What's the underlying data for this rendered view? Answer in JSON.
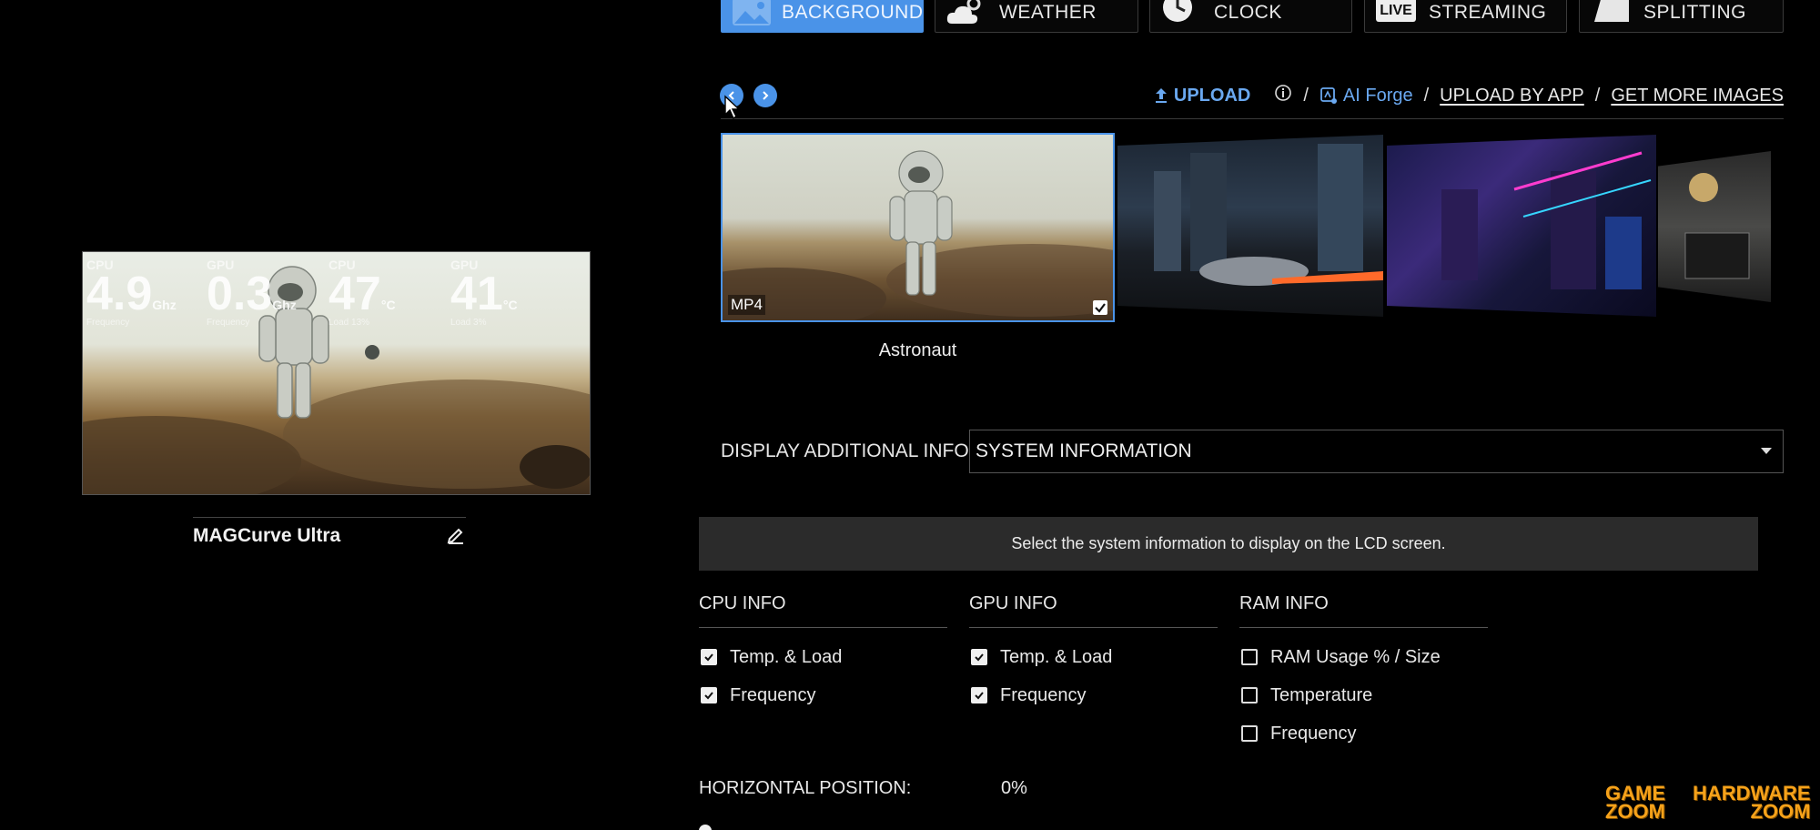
{
  "tabs": [
    {
      "label": "BACKGROUND",
      "icon": "image-icon",
      "active": true
    },
    {
      "label": "WEATHER",
      "icon": "weather-icon",
      "active": false
    },
    {
      "label": "CLOCK",
      "icon": "clock-icon",
      "active": false
    },
    {
      "label": "STREAMING",
      "icon": "live-icon",
      "badge": "LIVE",
      "active": false
    },
    {
      "label": "SPLITTING",
      "icon": "split-icon",
      "active": false
    }
  ],
  "preview": {
    "hud": [
      {
        "caption": "CPU",
        "value": "4.9",
        "unit": "Ghz",
        "sub": "Frequency"
      },
      {
        "caption": "GPU",
        "value": "0.3",
        "unit": "Ghz",
        "sub": "Frequency"
      },
      {
        "caption": "CPU",
        "value": "47",
        "unit": "°C",
        "sub": "Load    13%"
      },
      {
        "caption": "GPU",
        "value": "41",
        "unit": "°C",
        "sub": "Load    3%"
      }
    ],
    "device_name": "MAGCurve Ultra"
  },
  "header_links": {
    "upload": "UPLOAD",
    "ai_forge": "AI Forge",
    "separator": "/",
    "upload_by_app": "UPLOAD BY APP",
    "get_more_images": "GET MORE IMAGES"
  },
  "carousel": {
    "selected": {
      "badge": "MP4",
      "title": "Astronaut"
    }
  },
  "display_info": {
    "label": "DISPLAY ADDITIONAL INFO",
    "selected": "SYSTEM INFORMATION",
    "hint": "Select the system information to display on the LCD screen."
  },
  "columns": [
    {
      "title": "CPU INFO",
      "options": [
        {
          "label": "Temp. & Load",
          "checked": true
        },
        {
          "label": "Frequency",
          "checked": true
        }
      ]
    },
    {
      "title": "GPU INFO",
      "options": [
        {
          "label": "Temp. & Load",
          "checked": true
        },
        {
          "label": "Frequency",
          "checked": true
        }
      ]
    },
    {
      "title": "RAM INFO",
      "options": [
        {
          "label": "RAM Usage % / Size",
          "checked": false
        },
        {
          "label": "Temperature",
          "checked": false
        },
        {
          "label": "Frequency",
          "checked": false
        }
      ]
    }
  ],
  "horizontal_position": {
    "label": "HORIZONTAL POSITION:",
    "value": "0%"
  },
  "watermarks": {
    "left": [
      "GAME",
      "ZOOM"
    ],
    "right": [
      "HARDWARE",
      "ZOOM"
    ]
  },
  "colors": {
    "accent": "#4a93e8",
    "link": "#6aa8f0",
    "watermark": "#f6a21a"
  }
}
